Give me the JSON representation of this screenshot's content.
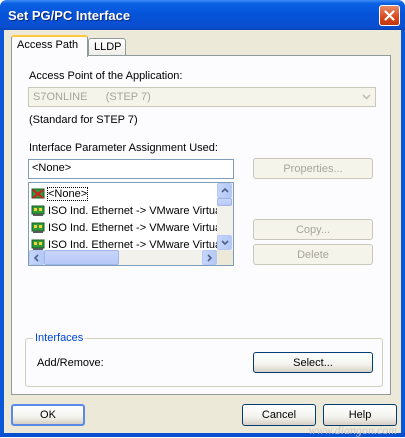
{
  "window": {
    "title": "Set PG/PC Interface"
  },
  "tabs": [
    {
      "label": "Access Path"
    },
    {
      "label": "LLDP"
    }
  ],
  "access_point": {
    "label": "Access Point of the Application:",
    "value": "S7ONLINE      (STEP 7)",
    "note": "(Standard for STEP 7)"
  },
  "param": {
    "label": "Interface Parameter Assignment Used:",
    "value": "<None>"
  },
  "list": {
    "items": [
      {
        "label": "<None>",
        "icon": "none-network-icon"
      },
      {
        "label": "ISO Ind. Ethernet -> VMware Virtua",
        "icon": "network-card-icon"
      },
      {
        "label": "ISO Ind. Ethernet -> VMware Virtua",
        "icon": "network-card-icon"
      },
      {
        "label": "ISO Ind. Ethernet -> VMware Virtua",
        "icon": "network-card-icon"
      }
    ]
  },
  "buttons": {
    "properties": "Properties...",
    "copy": "Copy...",
    "delete": "Delete",
    "select": "Select...",
    "ok": "OK",
    "cancel": "Cancel",
    "help": "Help"
  },
  "interfaces": {
    "group_label": "Interfaces",
    "add_remove": "Add/Remove:"
  },
  "watermark": "www.diangon.com",
  "colors": {
    "titlebar": "#0553d8",
    "dialog_bg": "#ece9d8",
    "tab_highlight": "#ffc83c"
  }
}
